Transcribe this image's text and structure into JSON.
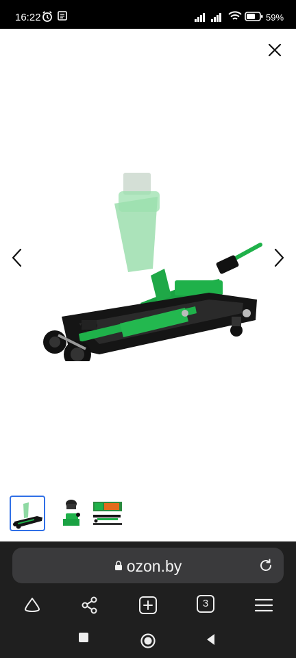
{
  "status_bar": {
    "time": "16:22",
    "battery_text": "59%",
    "icons": [
      "alarm-icon",
      "notification-icon",
      "signal-icon",
      "signal-icon-2",
      "wifi-icon",
      "battery-icon"
    ]
  },
  "viewer": {
    "close_icon": "close-icon",
    "prev_icon": "chevron-left-icon",
    "next_icon": "chevron-right-icon",
    "thumbnails_count": 3,
    "selected_thumbnail": 1
  },
  "browser": {
    "url": "ozon.by",
    "tabs_count": "3",
    "icons": [
      "lock-icon",
      "reload-icon",
      "home-icon",
      "share-icon",
      "new-tab-icon",
      "menu-icon"
    ]
  },
  "system_nav": {
    "icons": [
      "recents-icon",
      "home-circle-icon",
      "back-icon"
    ]
  },
  "colors": {
    "accent_green": "#1fb14a",
    "selection_blue": "#2f6fe6",
    "browser_bg": "#1f1f1f",
    "url_pill_bg": "#3a3a3c"
  }
}
